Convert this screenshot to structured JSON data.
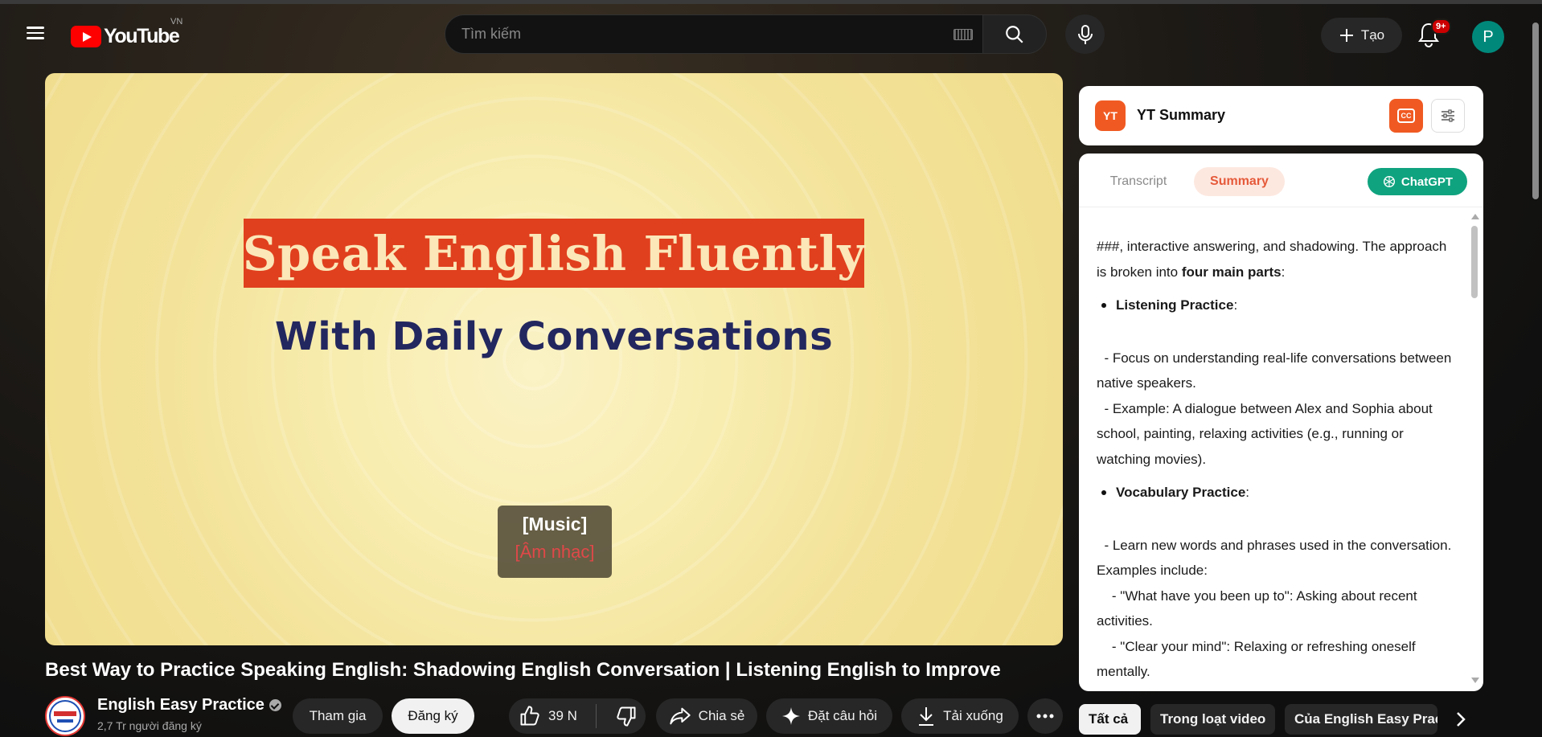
{
  "header": {
    "logo_text": "YouTube",
    "country_code": "VN",
    "search_placeholder": "Tìm kiếm",
    "create_label": "Tạo",
    "notification_count": "9+",
    "avatar_letter": "P"
  },
  "video": {
    "overlay_title": "Speak English Fluently",
    "overlay_subtitle": "With Daily Conversations",
    "caption_primary": "[Music]",
    "caption_secondary": "[Âm nhạc]",
    "title": "Best Way to Practice Speaking English: Shadowing English Conversation | Listening English to Improve"
  },
  "channel": {
    "name": "English Easy Practice",
    "subscribers": "2,7 Tr người đăng ký",
    "join_label": "Tham gia",
    "subscribe_label": "Đăng ký"
  },
  "actions": {
    "like_count": "39 N",
    "share_label": "Chia sẻ",
    "ask_label": "Đặt câu hỏi",
    "download_label": "Tải xuống"
  },
  "summary_panel": {
    "badge": "YT",
    "title": "YT Summary",
    "cc_label": "CC",
    "tab_transcript": "Transcript",
    "tab_summary": "Summary",
    "chatgpt_label": "ChatGPT",
    "intro_a": "###, interactive answering, and shadowing. The approach is broken into ",
    "intro_bold": "four main parts",
    "intro_c": ":",
    "section1_title": "Listening Practice",
    "section1_lines": [
      "  - Focus on understanding real-life conversations between native speakers.",
      "  - Example: A dialogue between Alex and Sophia about school, painting, relaxing activities (e.g., running or watching movies)."
    ],
    "section2_title": "Vocabulary Practice",
    "section2_lines": [
      "  - Learn new words and phrases used in the conversation. Examples include:",
      "    - \"What have you been up to\": Asking about recent activities.",
      "    - \"Clear your mind\": Relaxing or refreshing oneself mentally."
    ]
  },
  "chips": [
    "Tất cả",
    "Trong loạt video",
    "Của English Easy Practice"
  ],
  "colors": {
    "accent_red": "#ff0000",
    "summary_orange": "#f05a22",
    "chatgpt_green": "#10a37f"
  }
}
